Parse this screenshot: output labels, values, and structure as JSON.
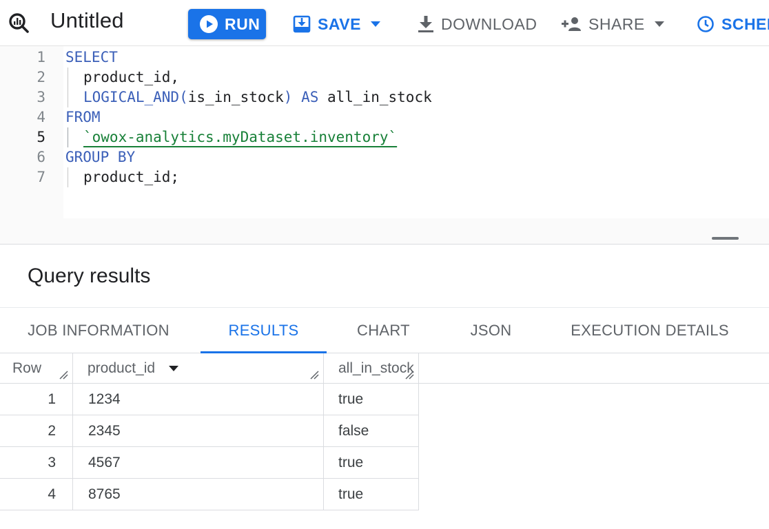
{
  "toolbar": {
    "title": "Untitled",
    "run_label": "RUN",
    "save_label": "SAVE",
    "download_label": "DOWNLOAD",
    "share_label": "SHARE",
    "schedule_label": "SCHED",
    "icons": [
      "query-icon",
      "play-icon",
      "save-icon",
      "download-icon",
      "share-person-icon",
      "clock-icon",
      "chevron-down-icon"
    ]
  },
  "editor": {
    "active_line": 5,
    "lines": [
      {
        "number": "1",
        "tokens": [
          {
            "text": "SELECT",
            "kind": "keyword"
          }
        ]
      },
      {
        "number": "2",
        "tokens": [
          {
            "text": "product_id,",
            "kind": "plain"
          }
        ]
      },
      {
        "number": "3",
        "tokens": [
          {
            "text": "LOGICAL_AND(",
            "kind": "keyword"
          },
          {
            "text": "is_in_stock",
            "kind": "plain"
          },
          {
            "text": ") AS ",
            "kind": "keyword"
          },
          {
            "text": "all_in_stock",
            "kind": "plain"
          }
        ]
      },
      {
        "number": "4",
        "tokens": [
          {
            "text": "FROM",
            "kind": "keyword"
          }
        ]
      },
      {
        "number": "5",
        "tokens": [
          {
            "text": "`owox-analytics.myDataset.inventory`",
            "kind": "string"
          }
        ]
      },
      {
        "number": "6",
        "tokens": [
          {
            "text": "GROUP BY",
            "kind": "keyword"
          }
        ]
      },
      {
        "number": "7",
        "tokens": [
          {
            "text": "product_id;",
            "kind": "plain"
          }
        ]
      }
    ]
  },
  "results": {
    "title": "Query results",
    "tabs": [
      {
        "label": "JOB INFORMATION",
        "active": false
      },
      {
        "label": "RESULTS",
        "active": true
      },
      {
        "label": "CHART",
        "active": false
      },
      {
        "label": "JSON",
        "active": false
      },
      {
        "label": "EXECUTION DETAILS",
        "active": false
      }
    ],
    "columns": [
      "Row",
      "product_id",
      "all_in_stock"
    ],
    "rows": [
      {
        "row": "1",
        "product_id": "1234",
        "all_in_stock": "true"
      },
      {
        "row": "2",
        "product_id": "2345",
        "all_in_stock": "false"
      },
      {
        "row": "3",
        "product_id": "4567",
        "all_in_stock": "true"
      },
      {
        "row": "4",
        "product_id": "8765",
        "all_in_stock": "true"
      }
    ]
  },
  "colors": {
    "accent": "#1a73e8",
    "keyword": "#3b5fb8",
    "string": "#188038",
    "muted_text": "#5f6368"
  }
}
